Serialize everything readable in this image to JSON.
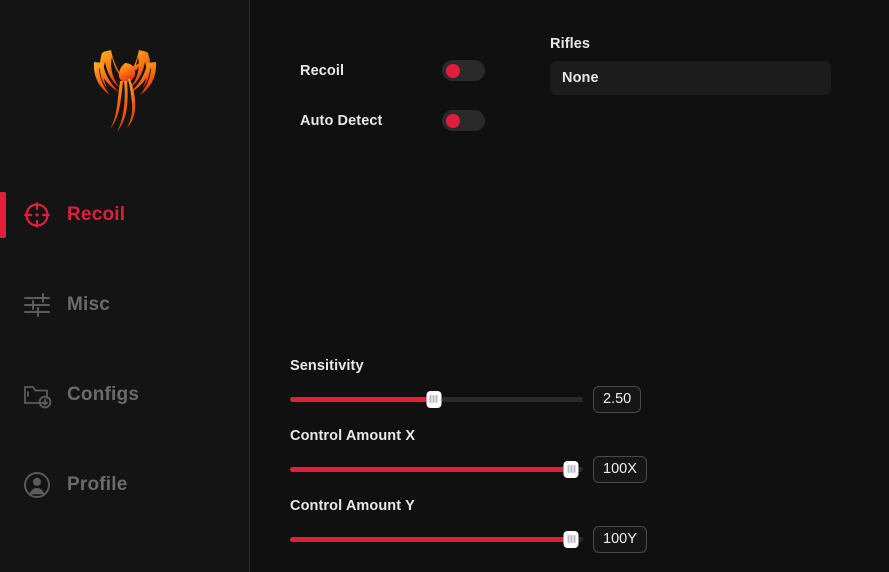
{
  "app": {
    "logo_name": "phoenix-logo",
    "background": "#101010",
    "sidebar_background": "#141414",
    "accent_color": "#e01f3d",
    "logo_gradient_from": "#ffb01f",
    "logo_gradient_to": "#e8380d"
  },
  "sidebar": {
    "items": [
      {
        "label": "Recoil",
        "icon": "crosshair-icon",
        "active": true
      },
      {
        "label": "Misc",
        "icon": "sliders-icon",
        "active": false
      },
      {
        "label": "Configs",
        "icon": "folder-download-icon",
        "active": false
      },
      {
        "label": "Profile",
        "icon": "user-circle-icon",
        "active": false
      }
    ]
  },
  "main": {
    "toggles": [
      {
        "label": "Recoil",
        "on": false
      },
      {
        "label": "Auto Detect",
        "on": false
      }
    ],
    "rifles": {
      "title": "Rifles",
      "selected": "None",
      "options": [
        "None"
      ]
    },
    "sliders": [
      {
        "label": "Sensitivity",
        "value": "2.50",
        "percent": 49
      },
      {
        "label": "Control Amount X",
        "value": "100X",
        "percent": 96
      },
      {
        "label": "Control Amount Y",
        "value": "100Y",
        "percent": 96
      }
    ]
  }
}
